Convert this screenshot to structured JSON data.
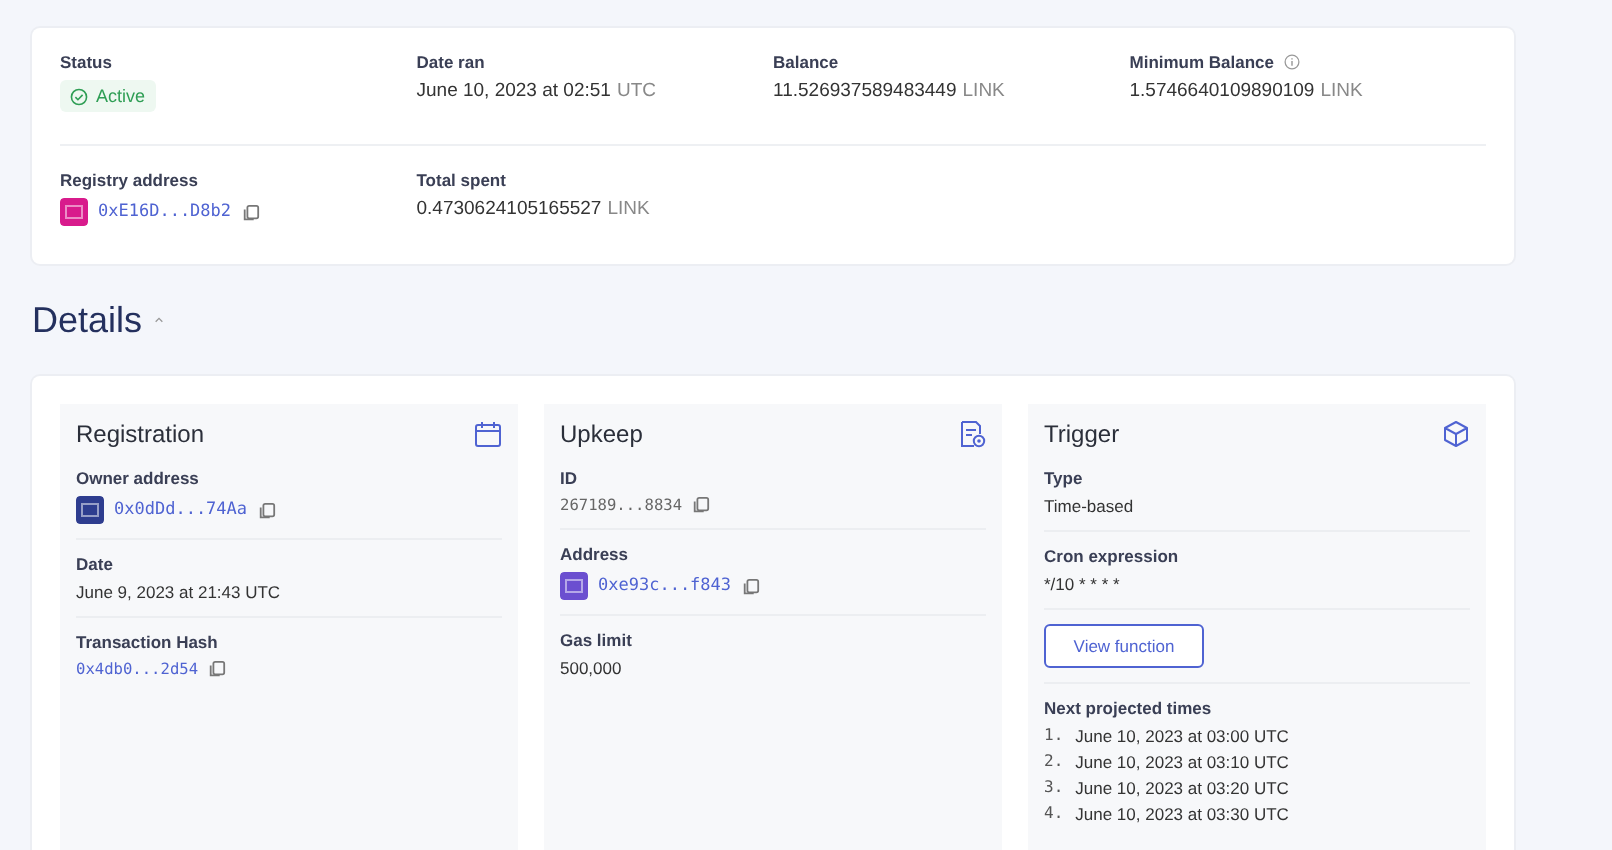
{
  "summary": {
    "rows": [
      [
        {
          "label": "Status",
          "kind": "status",
          "value": "Active"
        },
        {
          "label": "Date ran",
          "kind": "date",
          "value": "June 10, 2023 at 02:51",
          "unit": "UTC"
        },
        {
          "label": "Balance",
          "kind": "amount",
          "value": "11.526937589483449",
          "unit": "LINK"
        },
        {
          "label": "Minimum Balance",
          "kind": "amount",
          "info": true,
          "value": "1.5746640109890109",
          "unit": "LINK"
        }
      ],
      [
        {
          "label": "Registry address",
          "kind": "address",
          "value": "0xE16D...D8b2",
          "color": "#d81b8c"
        },
        {
          "label": "Total spent",
          "kind": "amount",
          "value": "0.4730624105165527",
          "unit": "LINK"
        }
      ]
    ]
  },
  "details": {
    "title": "Details",
    "expanded": true,
    "panels": [
      {
        "title": "Registration",
        "kind": "calendar",
        "fields": [
          {
            "label": "Owner address",
            "kind": "address",
            "value": "0x0dDd...74Aa",
            "color": "#2e3d8f"
          },
          {
            "label": "Date",
            "kind": "text",
            "value": "June 9, 2023 at 21:43 UTC"
          },
          {
            "label": "Transaction Hash",
            "kind": "link",
            "value": "0x4db0...2d54"
          }
        ]
      },
      {
        "title": "Upkeep",
        "kind": "document",
        "fields": [
          {
            "label": "ID",
            "kind": "mono",
            "value": "267189...8834"
          },
          {
            "label": "Address",
            "kind": "address",
            "value": "0xe93c...f843",
            "color": "#6b4fd0"
          },
          {
            "label": "Gas limit",
            "kind": "text",
            "value": "500,000"
          }
        ]
      },
      {
        "title": "Trigger",
        "kind": "cube",
        "fields": [
          {
            "label": "Type",
            "kind": "text",
            "value": "Time-based"
          },
          {
            "label": "Cron expression",
            "kind": "text",
            "value": "*/10 * * * *"
          },
          {
            "kind": "button",
            "value": "View function"
          },
          {
            "label": "Next projected times",
            "kind": "list",
            "items": [
              {
                "number": "1.",
                "value": "June 10, 2023 at 03:00 UTC"
              },
              {
                "number": "2.",
                "value": "June 10, 2023 at 03:10 UTC"
              },
              {
                "number": "3.",
                "value": "June 10, 2023 at 03:20 UTC"
              },
              {
                "number": "4.",
                "value": "June 10, 2023 at 03:30 UTC"
              }
            ]
          }
        ]
      }
    ]
  }
}
